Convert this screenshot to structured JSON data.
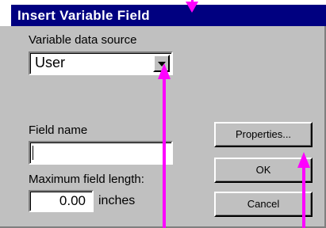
{
  "dialog": {
    "title": "Insert Variable Field",
    "variable_source_label": "Variable data source",
    "variable_source_value": "User",
    "field_name_label": "Field name",
    "field_name_value": "",
    "max_length_label": "Maximum field length:",
    "max_length_value": "0.00",
    "max_length_unit": "inches"
  },
  "buttons": {
    "properties": "Properties...",
    "ok": "OK",
    "cancel": "Cancel"
  },
  "colors": {
    "titlebar": "#000080",
    "dialog_bg": "#c0c0c0",
    "annotation_arrows": "#ff00ff"
  }
}
